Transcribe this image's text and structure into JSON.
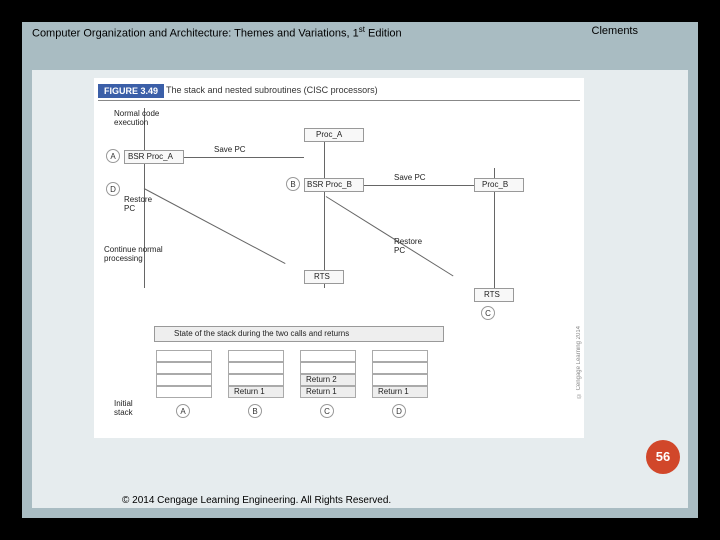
{
  "header": {
    "title_pre": "Computer Organization and Architecture: Themes and Variations, 1",
    "title_sup": "st",
    "title_post": " Edition",
    "author": "Clements"
  },
  "figure": {
    "label": "FIGURE 3.49",
    "caption": "The stack and nested subroutines (CISC processors)",
    "normal_code": "Normal code\nexecution",
    "bsr_a": "BSR Proc_A",
    "save_pc_1": "Save PC",
    "proc_a": "Proc_A",
    "bsr_b": "BSR Proc_B",
    "save_pc_2": "Save PC",
    "proc_b": "Proc_B",
    "rts_1": "RTS",
    "rts_2": "RTS",
    "restore_pc_1": "Restore\nPC",
    "restore_pc_2": "Restore\nPC",
    "continue": "Continue normal\nprocessing",
    "marker_a": "A",
    "marker_b": "B",
    "marker_c": "C",
    "marker_d": "D",
    "stack_header": "State of the stack during the two calls and returns",
    "initial_stack": "Initial\nstack",
    "return1": "Return 1",
    "return2": "Return 2",
    "credit": "© Cengage Learning 2014"
  },
  "page_number": "56",
  "footer": "© 2014 Cengage Learning Engineering. All Rights Reserved."
}
